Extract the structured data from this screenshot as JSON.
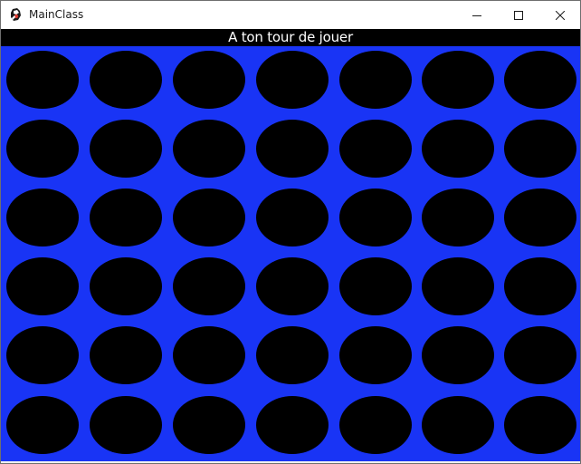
{
  "window": {
    "title": "MainClass",
    "app_icon": "java-duke-icon",
    "buttons": {
      "minimize_icon": "minimize-icon",
      "maximize_icon": "maximize-icon",
      "close_icon": "close-icon"
    }
  },
  "status": {
    "message": "A ton tour de jouer"
  },
  "board": {
    "game": "connect-four",
    "rows": 6,
    "columns": 7,
    "board_color": "#1934f5",
    "empty_slot_color": "#000000",
    "status_bar_color": "#000000",
    "status_text_color": "#ffffff",
    "cells": [
      [
        "empty",
        "empty",
        "empty",
        "empty",
        "empty",
        "empty",
        "empty"
      ],
      [
        "empty",
        "empty",
        "empty",
        "empty",
        "empty",
        "empty",
        "empty"
      ],
      [
        "empty",
        "empty",
        "empty",
        "empty",
        "empty",
        "empty",
        "empty"
      ],
      [
        "empty",
        "empty",
        "empty",
        "empty",
        "empty",
        "empty",
        "empty"
      ],
      [
        "empty",
        "empty",
        "empty",
        "empty",
        "empty",
        "empty",
        "empty"
      ],
      [
        "empty",
        "empty",
        "empty",
        "empty",
        "empty",
        "empty",
        "empty"
      ]
    ]
  }
}
